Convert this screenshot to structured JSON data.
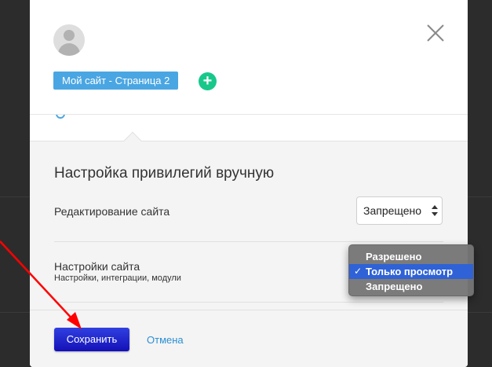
{
  "header": {
    "site_tag": "Мой сайт - Страница 2",
    "add_symbol": "+"
  },
  "section": {
    "title": "Настройка привилегий вручную"
  },
  "rows": [
    {
      "label": "Редактирование сайта",
      "selected_value": "Запрещено"
    },
    {
      "label": "Настройки сайта",
      "sublabel": "Настройки, интеграции, модули"
    }
  ],
  "dropdown": {
    "options": [
      "Разрешено",
      "Только просмотр",
      "Запрещено"
    ],
    "selected_index": 1,
    "check_mark": "✓"
  },
  "footer": {
    "save_label": "Сохранить",
    "cancel_label": "Отмена"
  },
  "colors": {
    "accent": "#4aa6e2",
    "add_button": "#18c88b",
    "save_button": "#1410b8",
    "annotation_arrow": "#ff0000"
  }
}
